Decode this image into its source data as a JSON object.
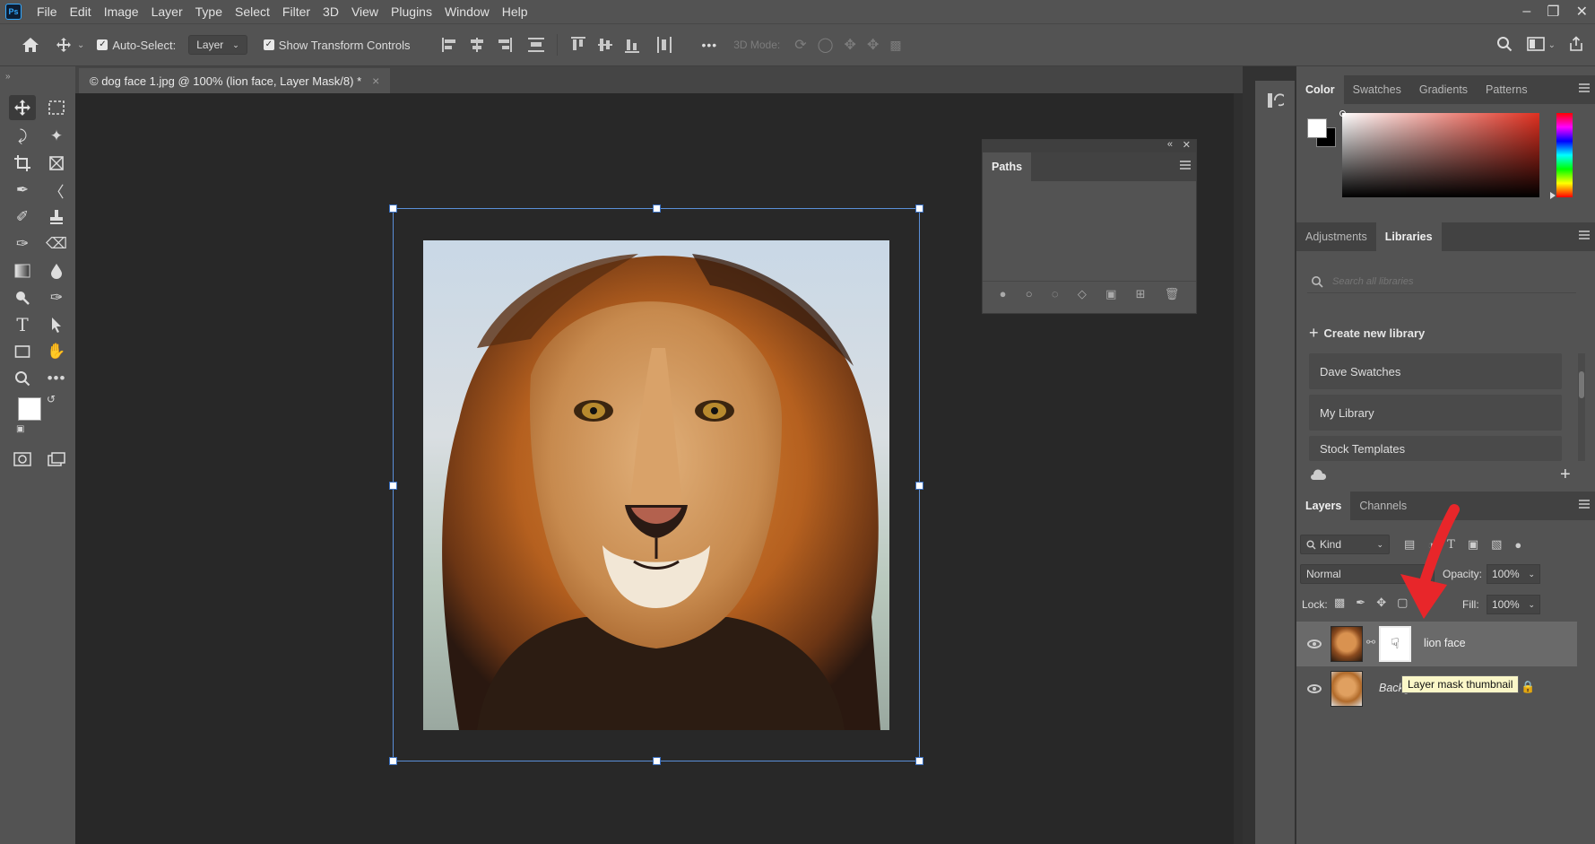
{
  "menubar": {
    "logo": "Ps",
    "items": [
      "File",
      "Edit",
      "Image",
      "Layer",
      "Type",
      "Select",
      "Filter",
      "3D",
      "View",
      "Plugins",
      "Window",
      "Help"
    ]
  },
  "options_bar": {
    "auto_select_label": "Auto-Select:",
    "auto_select_value": "Layer",
    "show_transform_label": "Show Transform Controls",
    "more": "•••",
    "mode_3d": "3D Mode:"
  },
  "document": {
    "tab_title": "© dog face 1.jpg @ 100% (lion face, Layer Mask/8) *",
    "close": "×"
  },
  "paths_panel": {
    "title": "Paths",
    "collapse": "«",
    "close": "✕"
  },
  "color_panel": {
    "tabs": [
      "Color",
      "Swatches",
      "Gradients",
      "Patterns"
    ]
  },
  "libraries_panel": {
    "tabs": [
      "Adjustments",
      "Libraries"
    ],
    "search_placeholder": "Search all libraries",
    "create_label": "Create new library",
    "libraries": [
      "Dave Swatches",
      "My Library",
      "Stock Templates"
    ]
  },
  "layers_panel": {
    "tabs": [
      "Layers",
      "Channels"
    ],
    "kind_label": "Kind",
    "blend_mode": "Normal",
    "opacity_label": "Opacity:",
    "opacity_value": "100%",
    "lock_label": "Lock:",
    "fill_label": "Fill:",
    "fill_value": "100%",
    "layers": [
      {
        "name": "lion face",
        "selected": true
      },
      {
        "name": "Background",
        "locked": true
      }
    ],
    "tooltip": "Layer mask thumbnail"
  },
  "colors": {
    "accent": "#31a8ff",
    "arrow": "#e8262a",
    "transform_box": "#5a8fd8"
  }
}
